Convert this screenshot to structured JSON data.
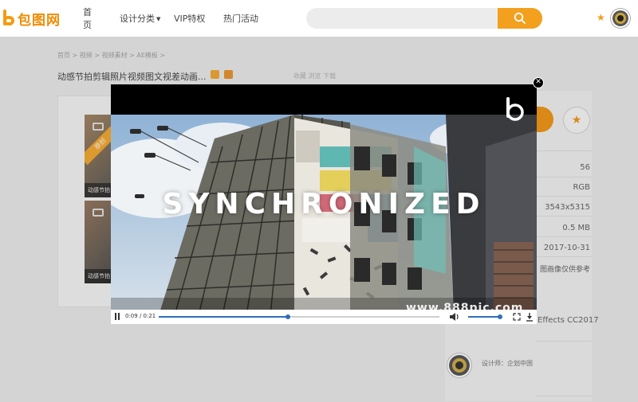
{
  "header": {
    "logo_text": "包图网",
    "nav": [
      {
        "label": "首页"
      },
      {
        "label": "设计分类"
      },
      {
        "label": "VIP特权"
      },
      {
        "label": "热门活动"
      },
      {
        "label": "···"
      }
    ],
    "search_placeholder": ""
  },
  "page": {
    "breadcrumb": "首页 > 视频 > 视频素材 > AE模板 >",
    "title": "动感节拍剪辑照片视频图文视差动画...",
    "meta": "收藏  浏览  下载"
  },
  "thumbs": [
    {
      "caption": "动感节拍",
      "ribbon": "原创"
    },
    {
      "caption": "动感节拍",
      "ribbon": ""
    }
  ],
  "info": {
    "rows": [
      {
        "value": "56"
      },
      {
        "value": "RGB"
      },
      {
        "value": "3543x5315"
      },
      {
        "value": "0.5 MB"
      },
      {
        "value": "2017-10-31"
      },
      {
        "value": "图画像仅供参考"
      }
    ],
    "software": "Effects CC2017",
    "designer": "设计师：企划中国"
  },
  "video": {
    "headline": "SYNCHRONIZED",
    "watermark": "www.888pic.com",
    "time": "0:09 / 0:21",
    "progress": 0.46,
    "volume": 1.0
  },
  "colors": {
    "accent": "#f08c00",
    "player_blue": "#2f6fb5"
  }
}
